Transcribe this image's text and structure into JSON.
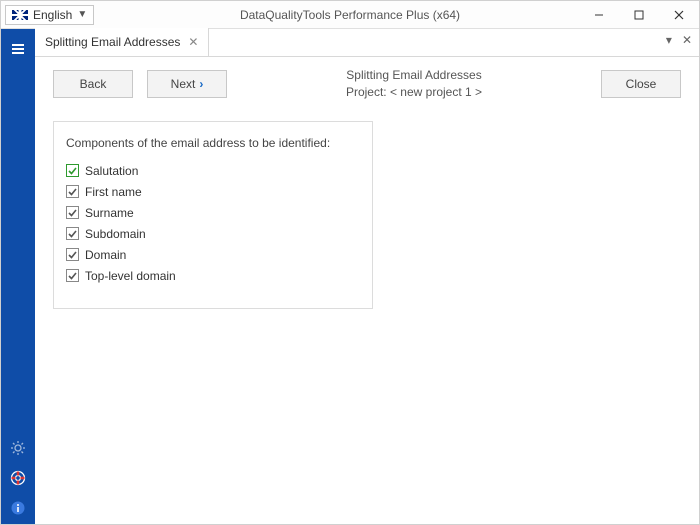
{
  "titlebar": {
    "language": "English",
    "app_title": "DataQualityTools Performance Plus (x64)"
  },
  "tab": {
    "label": "Splitting Email Addresses"
  },
  "header": {
    "back_label": "Back",
    "next_label": "Next",
    "close_label": "Close",
    "title": "Splitting Email Addresses",
    "project": "Project: < new project 1 >"
  },
  "panel": {
    "title": "Components of the email address to be identified:",
    "items": {
      "0": {
        "label": "Salutation"
      },
      "1": {
        "label": "First name"
      },
      "2": {
        "label": "Surname"
      },
      "3": {
        "label": "Subdomain"
      },
      "4": {
        "label": "Domain"
      },
      "5": {
        "label": "Top-level domain"
      }
    }
  }
}
